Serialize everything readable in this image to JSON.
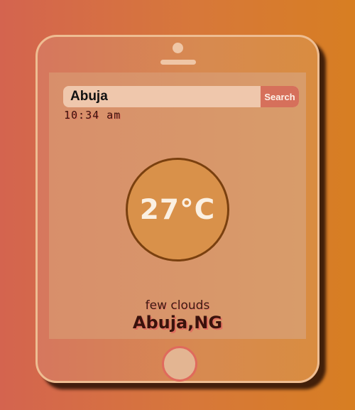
{
  "search": {
    "value": "Abuja",
    "button_label": "Search"
  },
  "time": "10:34 am",
  "weather": {
    "temperature": "27°C",
    "description": "few clouds",
    "location": "Abuja,NG"
  }
}
